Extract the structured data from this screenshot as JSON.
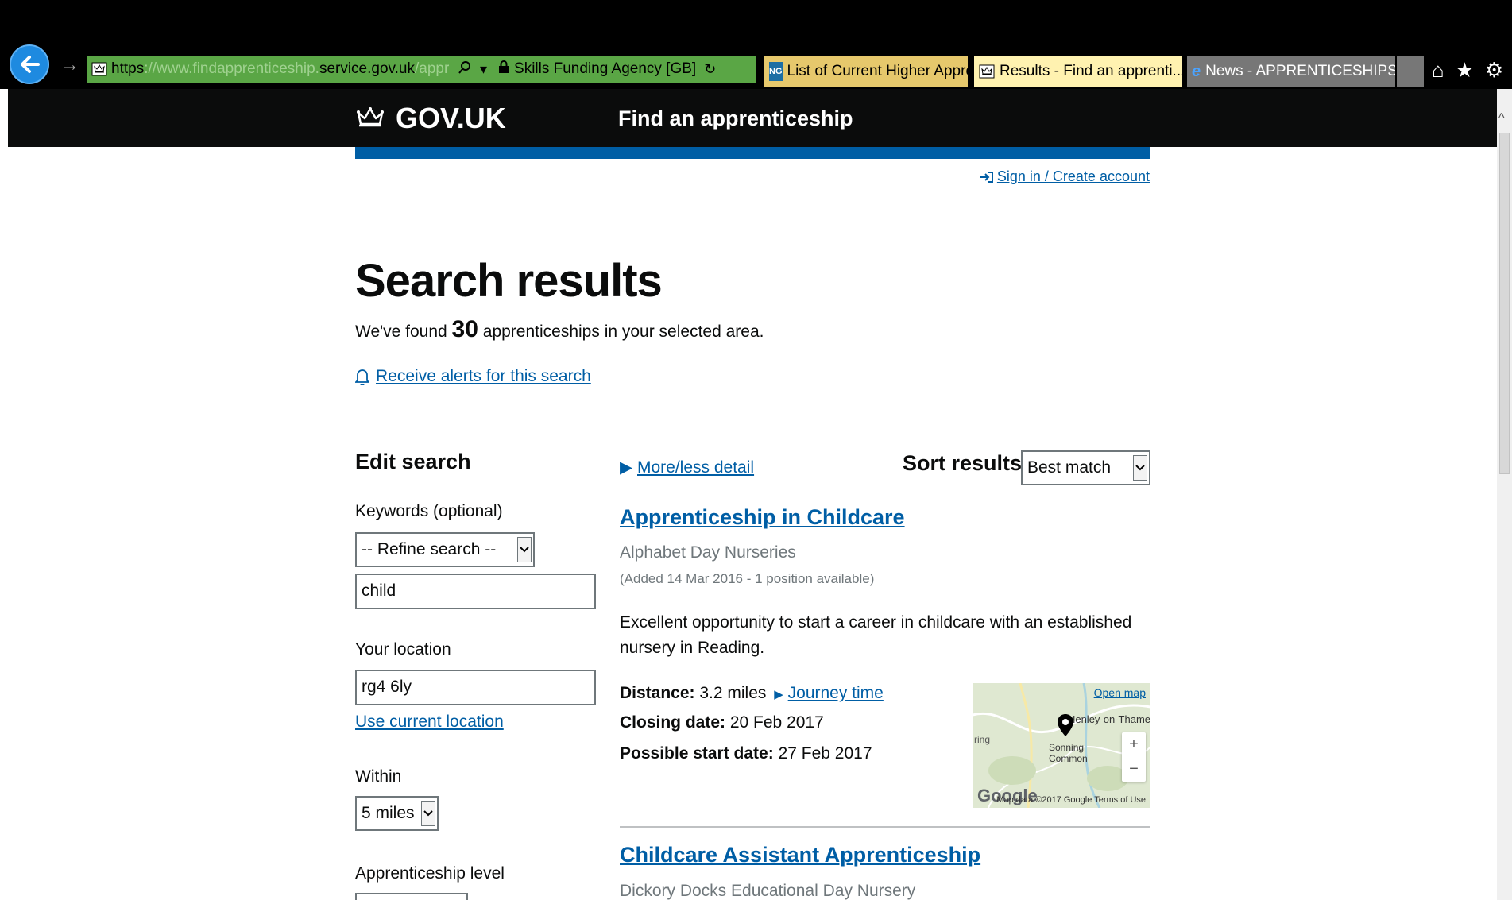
{
  "browser": {
    "address": {
      "scheme": "https",
      "host_prefix": "://www.findapprenticeship.",
      "host_domain": "service.gov.uk",
      "path": "/apprenticeships?Ap",
      "certificate": "Skills Funding Agency [GB]"
    },
    "tabs": [
      {
        "label": "List of Current Higher Appre...",
        "icon": "ng-favicon-icon"
      },
      {
        "label": "Results - Find an apprenti...",
        "icon": "govuk-favicon-icon",
        "active": true,
        "close": "×"
      },
      {
        "label": "News - APPRENTICESHIPS: D...",
        "icon": "ie-favicon-icon"
      }
    ]
  },
  "header": {
    "logo_text": "GOV.UK",
    "service_name": "Find an apprenticeship"
  },
  "account": {
    "signin_label": "Sign in / Create account"
  },
  "results_header": {
    "title": "Search results",
    "found_prefix": "We've found",
    "found_count": "30",
    "found_suffix": "apprenticeships in your selected area.",
    "alerts_label": "Receive alerts for this search"
  },
  "edit_search": {
    "heading": "Edit search",
    "keywords_label": "Keywords (optional)",
    "refine_selected": "-- Refine search --",
    "keywords_value": "child",
    "location_label": "Your location",
    "location_value": "rg4 6ly",
    "use_location_label": "Use current location",
    "within_label": "Within",
    "within_selected": "5 miles",
    "level_label": "Apprenticeship level"
  },
  "controls": {
    "more_less_label": "More/less detail",
    "sort_heading": "Sort results",
    "sort_selected": "Best match"
  },
  "results": [
    {
      "title": "Apprenticeship in Childcare",
      "employer": "Alphabet Day Nurseries",
      "meta": "(Added 14 Mar 2016 - 1 position available)",
      "description": "Excellent opportunity to start a career in childcare with an established nursery in Reading.",
      "distance_label": "Distance:",
      "distance_value": "3.2 miles",
      "journey_label": "Journey time",
      "closing_label": "Closing date:",
      "closing_value": "20 Feb 2017",
      "start_label": "Possible start date:",
      "start_value": "27 Feb 2017",
      "map": {
        "open_label": "Open map",
        "town": "Henley-on-Thame",
        "common_line1": "Sonning",
        "common_line2": "Common",
        "edge_label": "ring",
        "brand": "Google",
        "attribution": "Map data ©2017 Google   Terms of Use"
      }
    },
    {
      "title": "Childcare Assistant Apprenticeship",
      "employer": "Dickory Docks Educational Day Nursery"
    }
  ]
}
